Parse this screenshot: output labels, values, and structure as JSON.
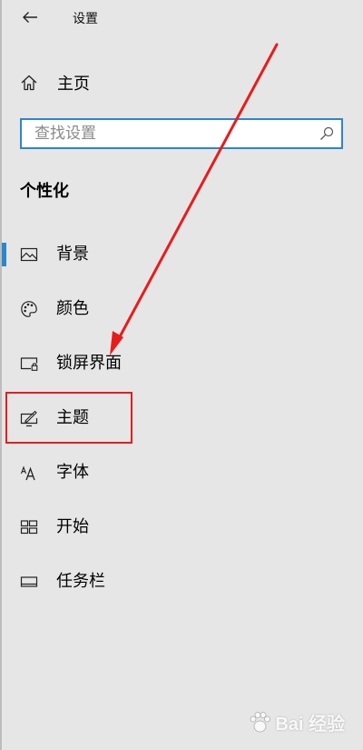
{
  "window": {
    "title": "设置"
  },
  "nav": {
    "home_label": "主页"
  },
  "search": {
    "placeholder": "查找设置",
    "value": ""
  },
  "section": {
    "title": "个性化"
  },
  "menu": {
    "items": [
      {
        "label": "背景",
        "icon": "picture-icon",
        "active": true
      },
      {
        "label": "颜色",
        "icon": "palette-icon",
        "active": false
      },
      {
        "label": "锁屏界面",
        "icon": "lock-screen-icon",
        "active": false
      },
      {
        "label": "主题",
        "icon": "theme-icon",
        "active": false,
        "highlighted": true
      },
      {
        "label": "字体",
        "icon": "font-icon",
        "active": false
      },
      {
        "label": "开始",
        "icon": "start-icon",
        "active": false
      },
      {
        "label": "任务栏",
        "icon": "taskbar-icon",
        "active": false
      }
    ]
  },
  "annotation": {
    "color": "#e81c1c"
  },
  "colors": {
    "background": "#e6e6e6",
    "accent": "#2a87cf",
    "annotation": "#e81c1c"
  },
  "watermark": {
    "text": "Bai 经验"
  }
}
